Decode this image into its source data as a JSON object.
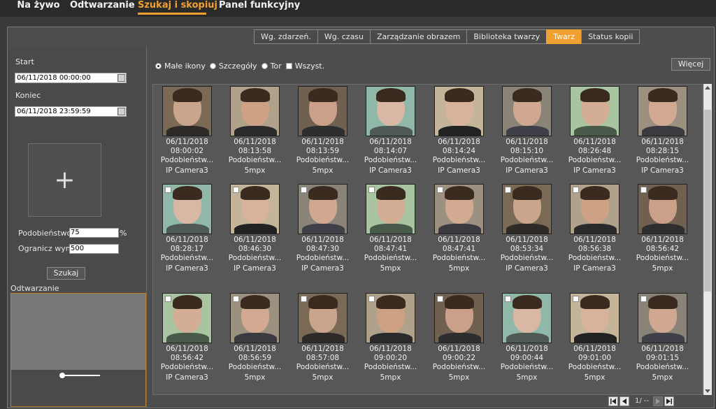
{
  "nav": {
    "items": [
      "Na żywo",
      "Odtwarzanie",
      "Szukaj i skopiuj",
      "Panel funkcyjny"
    ],
    "active": 2
  },
  "subtabs": {
    "items": [
      "Wg. zdarzeń.",
      "Wg. czasu",
      "Zarządzanie obrazem",
      "Biblioteka twarzy",
      "Twarz",
      "Status kopii"
    ],
    "active": 4
  },
  "left": {
    "start_label": "Start",
    "start_value": "06/11/2018 00:00:00",
    "end_label": "Koniec",
    "end_value": "06/11/2018 23:59:59",
    "add_symbol": "+",
    "similarity_label": "Podobieństwo",
    "similarity_value": "75",
    "similarity_unit": "%",
    "limit_label": "Ogranicz wyniki",
    "limit_value": "500",
    "search_button": "Szukaj",
    "playback_label": "Odtwarzanie"
  },
  "view_options": {
    "small_icons": "Małe ikony",
    "details": "Szczegóły",
    "track": "Tor",
    "all": "Wszyst.",
    "selected": "small_icons"
  },
  "more_button": "Więcej",
  "results": [
    {
      "date": "06/11/2018",
      "time": "08:00:02",
      "similarity": "Podobieństw...",
      "source": "IP Camera3",
      "checkbox": false
    },
    {
      "date": "06/11/2018",
      "time": "08:13:58",
      "similarity": "Podobieństw...",
      "source": "5mpx",
      "checkbox": false
    },
    {
      "date": "06/11/2018",
      "time": "08:13:59",
      "similarity": "Podobieństw...",
      "source": "5mpx",
      "checkbox": false
    },
    {
      "date": "06/11/2018",
      "time": "08:14:07",
      "similarity": "Podobieństw...",
      "source": "IP Camera3",
      "checkbox": false
    },
    {
      "date": "06/11/2018",
      "time": "08:14:24",
      "similarity": "Podobieństw...",
      "source": "IP Camera3",
      "checkbox": false
    },
    {
      "date": "06/11/2018",
      "time": "08:15:10",
      "similarity": "Podobieństw...",
      "source": "IP Camera3",
      "checkbox": false
    },
    {
      "date": "06/11/2018",
      "time": "08:26:48",
      "similarity": "Podobieństw...",
      "source": "IP Camera3",
      "checkbox": false
    },
    {
      "date": "06/11/2018",
      "time": "08:28:15",
      "similarity": "Podobieństw...",
      "source": "IP Camera3",
      "checkbox": false
    },
    {
      "date": "06/11/2018",
      "time": "08:28:17",
      "similarity": "Podobieństw...",
      "source": "IP Camera3",
      "checkbox": true
    },
    {
      "date": "06/11/2018",
      "time": "08:46:30",
      "similarity": "Podobieństw...",
      "source": "IP Camera3",
      "checkbox": true
    },
    {
      "date": "06/11/2018",
      "time": "08:47:30",
      "similarity": "Podobieństw...",
      "source": "IP Camera3",
      "checkbox": true
    },
    {
      "date": "06/11/2018",
      "time": "08:47:41",
      "similarity": "Podobieństw...",
      "source": "5mpx",
      "checkbox": true
    },
    {
      "date": "06/11/2018",
      "time": "08:47:41",
      "similarity": "Podobieństw...",
      "source": "5mpx",
      "checkbox": true
    },
    {
      "date": "06/11/2018",
      "time": "08:53:34",
      "similarity": "Podobieństw...",
      "source": "IP Camera3",
      "checkbox": true
    },
    {
      "date": "06/11/2018",
      "time": "08:56:38",
      "similarity": "Podobieństw...",
      "source": "IP Camera3",
      "checkbox": true
    },
    {
      "date": "06/11/2018",
      "time": "08:56:42",
      "similarity": "Podobieństw...",
      "source": "5mpx",
      "checkbox": true
    },
    {
      "date": "06/11/2018",
      "time": "08:56:42",
      "similarity": "Podobieństw...",
      "source": "IP Camera3",
      "checkbox": true
    },
    {
      "date": "06/11/2018",
      "time": "08:56:59",
      "similarity": "Podobieństw...",
      "source": "5mpx",
      "checkbox": true
    },
    {
      "date": "06/11/2018",
      "time": "08:57:08",
      "similarity": "Podobieństw...",
      "source": "5mpx",
      "checkbox": true
    },
    {
      "date": "06/11/2018",
      "time": "09:00:20",
      "similarity": "Podobieństw...",
      "source": "5mpx",
      "checkbox": true
    },
    {
      "date": "06/11/2018",
      "time": "09:00:22",
      "similarity": "Podobieństw...",
      "source": "5mpx",
      "checkbox": true
    },
    {
      "date": "06/11/2018",
      "time": "09:00:44",
      "similarity": "Podobieństw...",
      "source": "5mpx",
      "checkbox": true
    },
    {
      "date": "06/11/2018",
      "time": "09:01:00",
      "similarity": "Podobieństw...",
      "source": "5mpx",
      "checkbox": true
    },
    {
      "date": "06/11/2018",
      "time": "09:01:15",
      "similarity": "Podobieństw...",
      "source": "5mpx",
      "checkbox": true
    }
  ],
  "pager": {
    "text": "1/ --"
  },
  "colors": {
    "accent": "#f0a030",
    "background": "#3a3a3a",
    "panel": "#4d4d4d"
  },
  "icons": {
    "calendar": "calendar-icon",
    "add": "plus-icon",
    "first": "first-page-icon",
    "prev": "prev-page-icon",
    "next": "next-page-icon",
    "last": "last-page-icon"
  }
}
